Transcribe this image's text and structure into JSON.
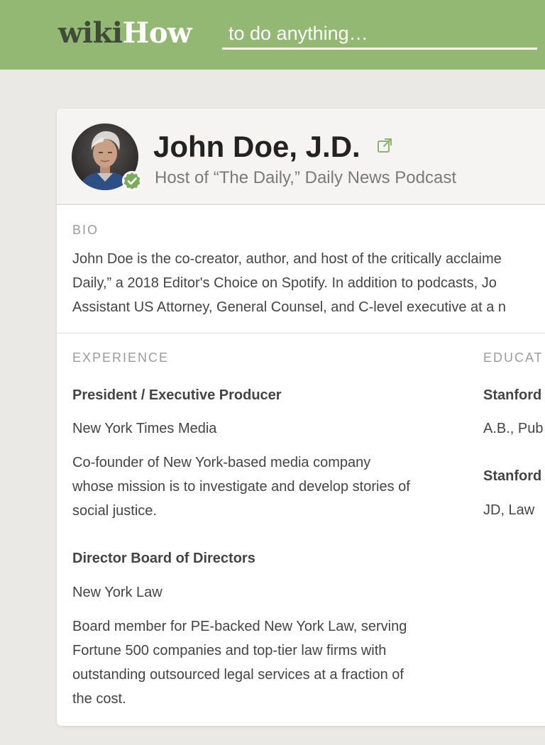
{
  "header": {
    "logo_wiki": "wiki",
    "logo_how": "How",
    "search_placeholder": "to do anything…",
    "colors": {
      "header_bg": "#93b874",
      "logo_dark": "#3f4a37"
    }
  },
  "profile": {
    "name": "John Doe, J.D.",
    "subtitle": "Host of “The Daily,” Daily News Podcast",
    "verified_icon": "check-badge-icon",
    "external_link_icon": "external-link-icon"
  },
  "bio": {
    "label": "BIO",
    "lines": [
      "John Doe is the co-creator, author, and host of the critically acclaime",
      "Daily,” a 2018 Editor's Choice on Spotify. In addition to podcasts, Jo",
      "Assistant US Attorney, General Counsel, and C-level executive at a n"
    ]
  },
  "experience": {
    "label": "EXPERIENCE",
    "items": [
      {
        "title": "President / Executive Producer",
        "org": "New York Times Media",
        "desc_lines": [
          "Co-founder of New York-based media company",
          "whose mission is to investigate and develop stories of",
          "social justice."
        ]
      },
      {
        "title": "Director Board of Directors",
        "org": "New York Law",
        "desc_lines": [
          "Board member for PE-backed New York Law, serving",
          "Fortune 500 companies and top-tier law firms with",
          "outstanding outsourced legal services at a fraction of",
          "the cost."
        ]
      }
    ]
  },
  "education": {
    "label": "EDUCAT",
    "items": [
      {
        "school": "Stanford",
        "degree": "A.B., Pub"
      },
      {
        "school": "Stanford",
        "degree": "JD, Law"
      }
    ]
  }
}
